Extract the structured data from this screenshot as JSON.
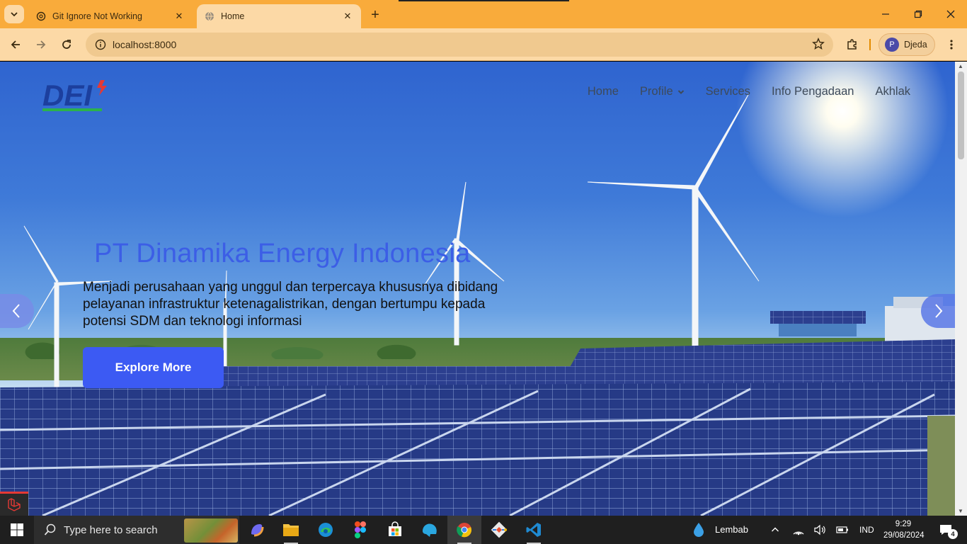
{
  "browser": {
    "tabs": [
      {
        "title": "Git Ignore Not Working",
        "icon": "chatgpt-icon",
        "active": false
      },
      {
        "title": "Home",
        "icon": "globe-icon",
        "active": true
      }
    ],
    "url": "localhost:8000",
    "profile": {
      "initial": "P",
      "name": "Djeda"
    },
    "accent": "#f9ab3b"
  },
  "site": {
    "logo_text": "DEI",
    "nav": [
      {
        "label": "Home"
      },
      {
        "label": "Profile",
        "dropdown": true
      },
      {
        "label": "Services"
      },
      {
        "label": "Info Pengadaan"
      },
      {
        "label": "Akhlak"
      }
    ],
    "hero": {
      "title": "PT Dinamika Energy Indonesia",
      "description": "Menjadi perusahaan yang unggul dan terpercaya khususnya dibidang pelayanan infrastruktur ketenagalistrikan, dengan bertumpu kepada potensi SDM dan teknologi informasi",
      "cta": "Explore More"
    },
    "colors": {
      "title": "#3c5ee6",
      "button": "#3c5af3"
    }
  },
  "taskbar": {
    "search_placeholder": "Type here to search",
    "weather": "Lembab",
    "language": "IND",
    "time": "9:29",
    "date": "29/08/2024",
    "notifications": "4",
    "apps": [
      "copilot-icon",
      "file-explorer-icon",
      "edge-icon",
      "figma-icon",
      "store-icon",
      "app-icon",
      "chrome-icon",
      "git-icon",
      "vscode-icon"
    ]
  }
}
